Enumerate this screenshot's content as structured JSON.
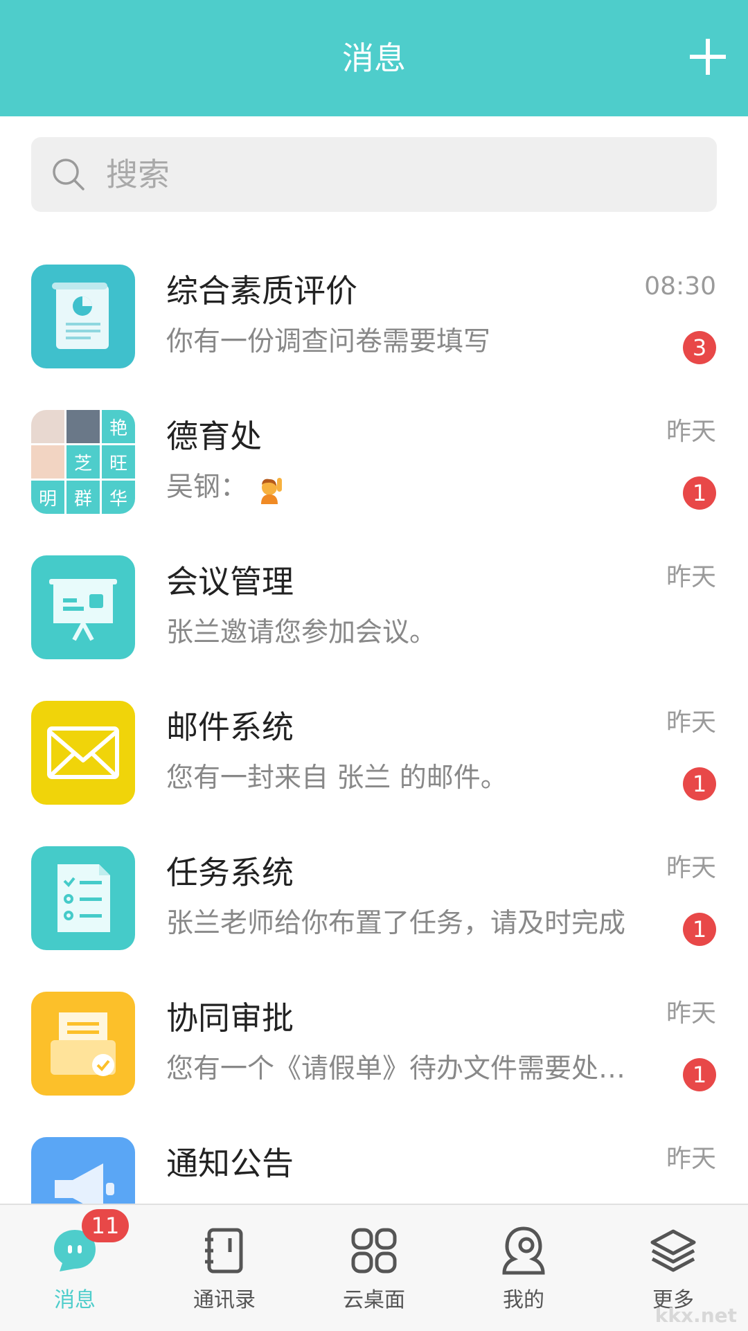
{
  "header": {
    "title": "消息",
    "accent": "#4ecdcb"
  },
  "search": {
    "placeholder": "搜索"
  },
  "conversations": [
    {
      "name": "综合素质评价",
      "preview": "你有一份调查问卷需要填写",
      "time": "08:30",
      "badge": "3",
      "icon": "report-document-icon",
      "color": "#3fc0cc"
    },
    {
      "name": "德育处",
      "preview": "吴钢：",
      "time": "昨天",
      "badge": "1",
      "icon": "group-avatar-grid",
      "color": "#4ecdcb",
      "grid": [
        "",
        "",
        "艳",
        "",
        "芝",
        "旺",
        "明",
        "群",
        "华"
      ]
    },
    {
      "name": "会议管理",
      "preview": "张兰邀请您参加会议。",
      "time": "昨天",
      "badge": "",
      "icon": "presentation-board-icon",
      "color": "#45cbc9"
    },
    {
      "name": "邮件系统",
      "preview": "您有一封来自 张兰 的邮件。",
      "time": "昨天",
      "badge": "1",
      "icon": "envelope-icon",
      "color": "#f0d40a"
    },
    {
      "name": "任务系统",
      "preview": "张兰老师给你布置了任务，请及时完成",
      "time": "昨天",
      "badge": "1",
      "icon": "checklist-icon",
      "color": "#45cbc9"
    },
    {
      "name": "协同审批",
      "preview": "您有一个《请假单》待办文件需要处…",
      "time": "昨天",
      "badge": "1",
      "icon": "approval-folder-icon",
      "color": "#fcc02a"
    },
    {
      "name": "通知公告",
      "preview": "",
      "time": "昨天",
      "badge": "",
      "icon": "megaphone-icon",
      "color": "#5aa6f5"
    }
  ],
  "tabbar": {
    "items": [
      {
        "label": "消息",
        "icon": "chat-bubble-icon",
        "badge": "11",
        "active": true
      },
      {
        "label": "通讯录",
        "icon": "contacts-book-icon"
      },
      {
        "label": "云桌面",
        "icon": "grid-apps-icon"
      },
      {
        "label": "我的",
        "icon": "person-icon"
      },
      {
        "label": "更多",
        "icon": "layers-icon"
      }
    ]
  },
  "watermark": "kkx.net"
}
